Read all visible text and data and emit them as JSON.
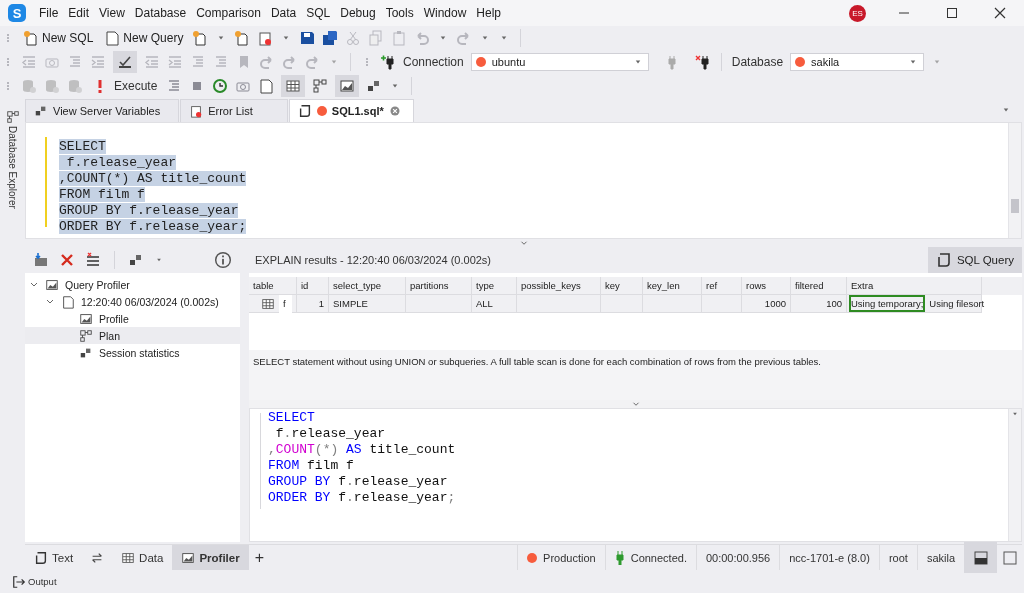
{
  "app": {
    "logo_letter": "S",
    "user_badge": "ES"
  },
  "menu": [
    "File",
    "Edit",
    "View",
    "Database",
    "Comparison",
    "Data",
    "SQL",
    "Debug",
    "Tools",
    "Window",
    "Help"
  ],
  "toolbar": {
    "new_sql": "New SQL",
    "new_query": "New Query",
    "execute": "Execute",
    "connection": {
      "label": "Connection",
      "value": "ubuntu",
      "color": "#f75c3d"
    },
    "database": {
      "label": "Database",
      "value": "sakila",
      "color": "#f75c3d"
    }
  },
  "side_strip": {
    "label": "Database Explorer"
  },
  "doc_tabs": [
    {
      "label": "View Server Variables",
      "kind": "variables",
      "selected": false
    },
    {
      "label": "Error List",
      "kind": "errors",
      "selected": false
    },
    {
      "label": "SQL1.sql*",
      "kind": "sql",
      "selected": true,
      "color": "#f75c3d"
    }
  ],
  "editor": {
    "selected": true,
    "lines": [
      "SELECT",
      " f.release_year",
      ",COUNT(*) AS title_count",
      "FROM film f",
      "GROUP BY f.release_year",
      "ORDER BY f.release_year;"
    ]
  },
  "profiler_tree": [
    {
      "label": "Query Profiler",
      "kind": "profiler",
      "expanded": true,
      "children": [
        {
          "label": "12:20:40 06/03/2024 (0.002s)",
          "kind": "session",
          "expanded": true,
          "children": [
            {
              "label": "Profile",
              "kind": "profile",
              "selected": false
            },
            {
              "label": "Plan",
              "kind": "plan",
              "selected": true
            },
            {
              "label": "Session statistics",
              "kind": "stats",
              "selected": false
            }
          ]
        }
      ]
    }
  ],
  "explain": {
    "title": "EXPLAIN results - 12:20:40 06/03/2024 (0.002s)",
    "sql_query_button": "SQL Query",
    "columns": [
      "table",
      "id",
      "select_type",
      "partitions",
      "type",
      "possible_keys",
      "key",
      "key_len",
      "ref",
      "rows",
      "filtered",
      "Extra"
    ],
    "rows": [
      [
        "f",
        "1",
        "SIMPLE",
        null,
        "ALL",
        null,
        null,
        null,
        null,
        "1000",
        "100",
        [
          {
            "text": "Using temporary;",
            "highlighted": true
          },
          {
            "text": "Using filesort",
            "highlighted": false
          }
        ]
      ]
    ],
    "description": "SELECT statement without using UNION or subqueries. A full table scan is done for each combination of rows from the previous tables."
  },
  "query_editor": {
    "lines": [
      [
        {
          "text": "SELECT",
          "kind": "keyword"
        }
      ],
      [
        {
          "text": " f",
          "kind": "ident"
        },
        {
          "text": ".",
          "kind": "punct"
        },
        {
          "text": "release_year",
          "kind": "ident"
        }
      ],
      [
        {
          "text": ",",
          "kind": "punct"
        },
        {
          "text": "COUNT",
          "kind": "function"
        },
        {
          "text": "(*)",
          "kind": "punct"
        },
        {
          "text": " AS ",
          "kind": "keyword"
        },
        {
          "text": "title_count",
          "kind": "ident"
        }
      ],
      [
        {
          "text": "FROM",
          "kind": "keyword"
        },
        {
          "text": " film f",
          "kind": "ident"
        }
      ],
      [
        {
          "text": "GROUP BY",
          "kind": "keyword"
        },
        {
          "text": " f",
          "kind": "ident"
        },
        {
          "text": ".",
          "kind": "punct"
        },
        {
          "text": "release_year",
          "kind": "ident"
        }
      ],
      [
        {
          "text": "ORDER BY",
          "kind": "keyword"
        },
        {
          "text": " f",
          "kind": "ident"
        },
        {
          "text": ".",
          "kind": "punct"
        },
        {
          "text": "release_year",
          "kind": "ident"
        },
        {
          "text": ";",
          "kind": "punct"
        }
      ]
    ]
  },
  "bottom_tabs": [
    {
      "label": "Text",
      "kind": "text",
      "selected": false
    },
    {
      "kind": "swap",
      "selected": false
    },
    {
      "label": "Data",
      "kind": "data",
      "selected": false
    },
    {
      "label": "Profiler",
      "kind": "profiler",
      "selected": true
    }
  ],
  "add_tab": "+",
  "status_bar": [
    {
      "text": "Production",
      "kind": "environment",
      "color": "#f75c3d"
    },
    {
      "text": "Connected.",
      "kind": "connection"
    },
    {
      "text": "00:00:00.956",
      "kind": "plain"
    },
    {
      "text": "ncc-1701-e (8.0)",
      "kind": "plain"
    },
    {
      "text": "root",
      "kind": "plain"
    },
    {
      "text": "sakila",
      "kind": "plain"
    }
  ],
  "output_tab": "Output"
}
